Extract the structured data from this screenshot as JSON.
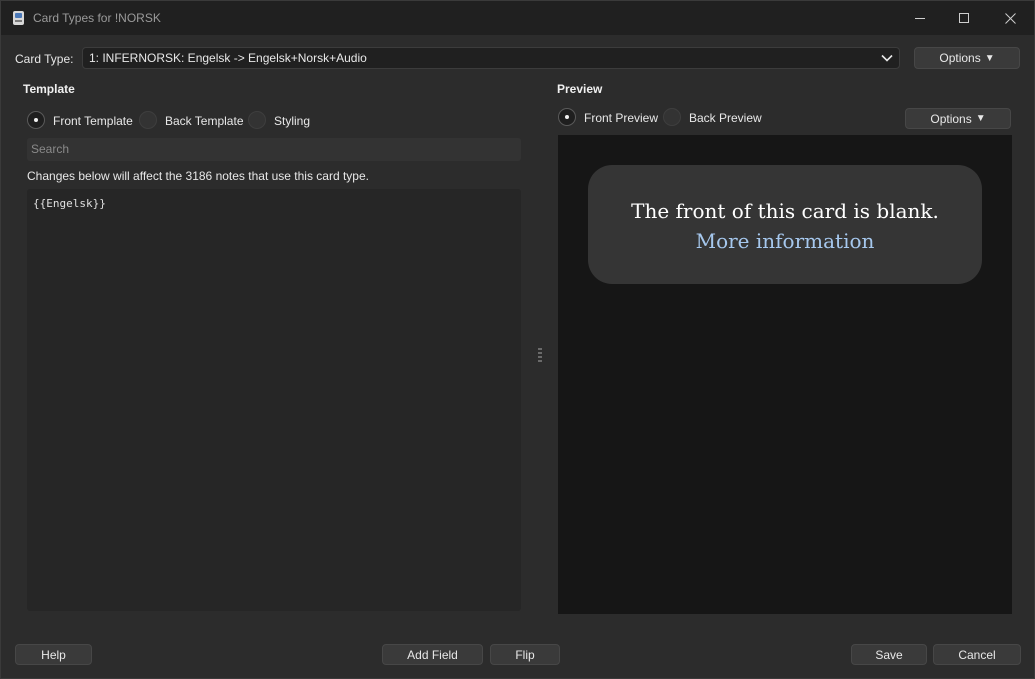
{
  "window": {
    "title": "Card Types for !NORSK",
    "icon": "anki-app-icon"
  },
  "card_type": {
    "label": "Card Type:",
    "selected": "1: INFERNORSK: Engelsk -> Engelsk+Norsk+Audio",
    "options_label": "Options"
  },
  "template": {
    "section_title": "Template",
    "radios": [
      {
        "label": "Front Template",
        "checked": true
      },
      {
        "label": "Back Template",
        "checked": false
      },
      {
        "label": "Styling",
        "checked": false
      }
    ],
    "search_placeholder": "Search",
    "notice": "Changes below will affect the 3186 notes that use this card type.",
    "editor_content": "{{Engelsk}}"
  },
  "preview": {
    "section_title": "Preview",
    "radios": [
      {
        "label": "Front Preview",
        "checked": true
      },
      {
        "label": "Back Preview",
        "checked": false
      }
    ],
    "options_label": "Options",
    "card_message": "The front of this card is blank.",
    "card_link": "More information"
  },
  "footer": {
    "help": "Help",
    "add_field": "Add Field",
    "flip": "Flip",
    "save": "Save",
    "cancel": "Cancel"
  },
  "colors": {
    "background": "#2c2c2c",
    "titlebar": "#202020",
    "preview_bg": "#161616",
    "card_bg": "#353535",
    "link": "#a6c8ee"
  }
}
